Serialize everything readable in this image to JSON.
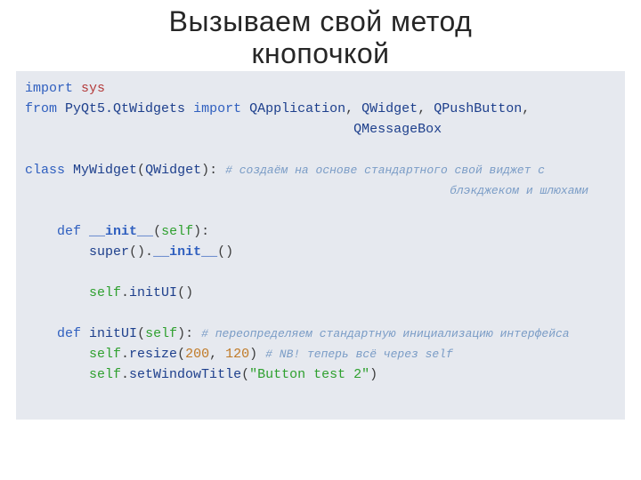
{
  "title": {
    "line1": "Вызываем свой метод",
    "line2": "кнопочкой"
  },
  "code": {
    "import_kw": "import",
    "sys": "sys",
    "from_kw": "from",
    "pyqt_mod": "PyQt5.QtWidgets",
    "import_kw2": "import",
    "qapp": "QApplication",
    "qwidget": "QWidget",
    "qpush": "QPushButton",
    "qmsg": "QMessageBox",
    "class_kw": "class",
    "class_name": "MyWidget",
    "class_base": "QWidget",
    "class_comment1": "# создаём на основе стандартного свой виджет с",
    "class_comment2": "блэкджеком и шлюхами",
    "def_kw": "def",
    "init_name": "__init__",
    "self_kw": "self",
    "super_call": "super",
    "initui_call": "initUI",
    "initui_name": "initUI",
    "initui_comment": "# переопределяем стандартную инициализацию интерфейса",
    "resize_call": "resize",
    "resize_w": "200",
    "resize_h": "120",
    "resize_comment": "# NB! теперь всё через self",
    "settitle_call": "setWindowTitle",
    "settitle_arg": "\"Button test 2\""
  }
}
